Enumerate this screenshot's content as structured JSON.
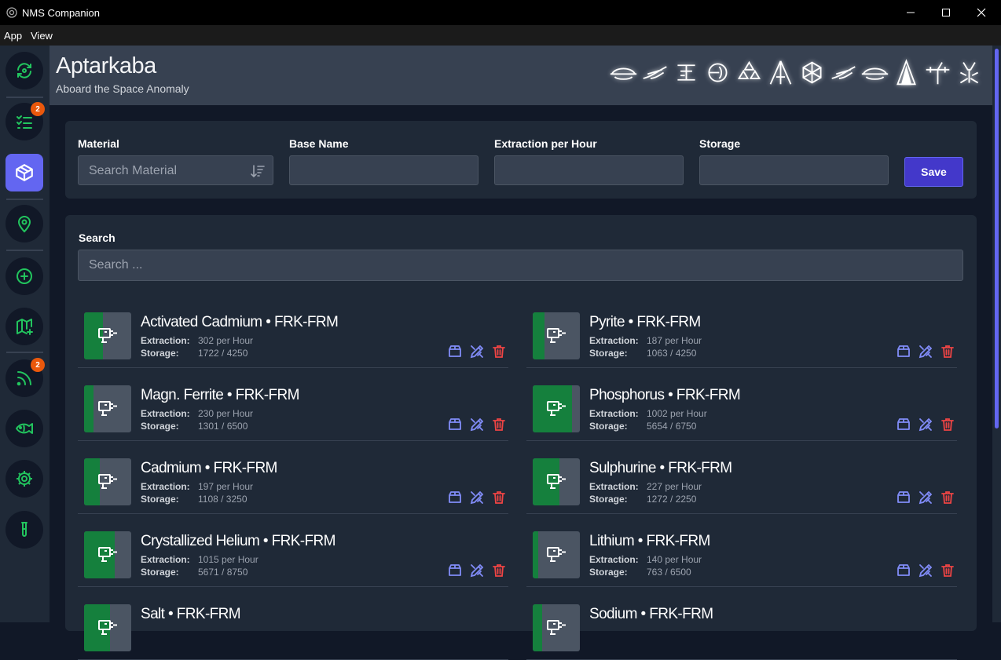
{
  "window": {
    "title": "NMS Companion",
    "minimize_icon": "minimize-icon",
    "maximize_icon": "maximize-icon",
    "close_icon": "close-icon"
  },
  "menu": {
    "items": [
      "App",
      "View"
    ]
  },
  "sidebar": {
    "items": [
      {
        "name": "sync",
        "icon": "sync-icon",
        "badge": ""
      },
      {
        "name": "tasks",
        "icon": "checklist-icon",
        "badge": "2"
      },
      {
        "name": "bases",
        "icon": "box-icon",
        "badge": ""
      },
      {
        "name": "locations",
        "icon": "map-pin-icon",
        "badge": ""
      },
      {
        "name": "add",
        "icon": "plus-circle-icon",
        "badge": ""
      },
      {
        "name": "add-map",
        "icon": "map-plus-icon",
        "badge": ""
      },
      {
        "name": "feed",
        "icon": "rss-icon",
        "badge": "2"
      },
      {
        "name": "fish",
        "icon": "fish-icon",
        "badge": ""
      },
      {
        "name": "settings",
        "icon": "gear-icon",
        "badge": ""
      },
      {
        "name": "test",
        "icon": "test-tube-icon",
        "badge": ""
      }
    ],
    "active": "bases"
  },
  "header": {
    "title": "Aptarkaba",
    "subtitle": "Aboard the Space Anomaly",
    "glyph_count": 12
  },
  "form": {
    "material_label": "Material",
    "material_placeholder": "Search Material",
    "base_label": "Base Name",
    "base_value": "",
    "extraction_label": "Extraction per Hour",
    "extraction_value": "",
    "storage_label": "Storage",
    "storage_value": "",
    "save_label": "Save"
  },
  "search": {
    "label": "Search",
    "placeholder": "Search ..."
  },
  "labels": {
    "extraction": "Extraction:",
    "storage": "Storage:"
  },
  "items": [
    {
      "name": "Activated Cadmium • FRK-FRM",
      "extraction": "302 per Hour",
      "storage": "1722 / 4250",
      "fill": 0.405
    },
    {
      "name": "Pyrite • FRK-FRM",
      "extraction": "187 per Hour",
      "storage": "1063 / 4250",
      "fill": 0.25
    },
    {
      "name": "Magn. Ferrite • FRK-FRM",
      "extraction": "230 per Hour",
      "storage": "1301 / 6500",
      "fill": 0.2
    },
    {
      "name": "Phosphorus • FRK-FRM",
      "extraction": "1002 per Hour",
      "storage": "5654 / 6750",
      "fill": 0.838
    },
    {
      "name": "Cadmium • FRK-FRM",
      "extraction": "197 per Hour",
      "storage": "1108 / 3250",
      "fill": 0.341
    },
    {
      "name": "Sulphurine • FRK-FRM",
      "extraction": "227 per Hour",
      "storage": "1272 / 2250",
      "fill": 0.565
    },
    {
      "name": "Crystallized Helium • FRK-FRM",
      "extraction": "1015 per Hour",
      "storage": "5671 / 8750",
      "fill": 0.648
    },
    {
      "name": "Lithium • FRK-FRM",
      "extraction": "140 per Hour",
      "storage": "763 / 6500",
      "fill": 0.117
    },
    {
      "name": "Salt • FRK-FRM",
      "extraction": "",
      "storage": "",
      "fill": 0.55
    },
    {
      "name": "Sodium • FRK-FRM",
      "extraction": "",
      "storage": "",
      "fill": 0.2
    }
  ],
  "colors": {
    "accent": "#6366f1",
    "fill": "#15803d",
    "delete": "#ef4444",
    "badge": "#ea580c"
  }
}
